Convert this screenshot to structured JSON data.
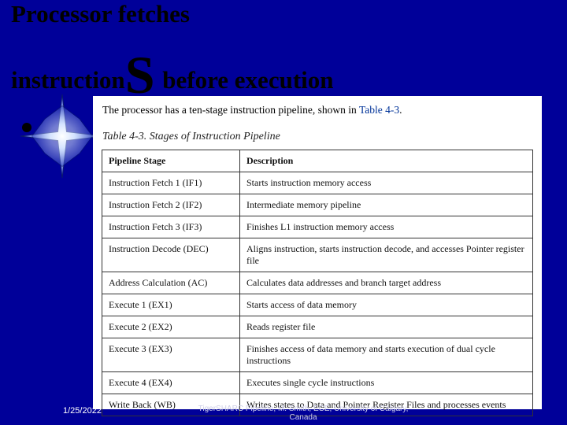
{
  "title": {
    "line1": "Processor fetches",
    "line2a": "instruction",
    "bigS": "S",
    "line2b": " before execution"
  },
  "intro": {
    "text_before": "The processor has a ten-stage instruction pipeline, shown in ",
    "link_text": "Table 4-3",
    "text_after": "."
  },
  "table_caption": "Table 4-3. Stages of Instruction Pipeline",
  "table": {
    "headers": [
      "Pipeline Stage",
      "Description"
    ],
    "rows": [
      [
        "Instruction Fetch 1 (IF1)",
        "Starts instruction memory access"
      ],
      [
        "Instruction Fetch 2 (IF2)",
        "Intermediate memory pipeline"
      ],
      [
        "Instruction Fetch 3 (IF3)",
        "Finishes L1 instruction memory access"
      ],
      [
        "Instruction Decode (DEC)",
        "Aligns instruction, starts instruction decode, and accesses Pointer register file"
      ],
      [
        "Address Calculation (AC)",
        "Calculates data addresses and branch target address"
      ],
      [
        "Execute 1 (EX1)",
        "Starts access of data memory"
      ],
      [
        "Execute 2 (EX2)",
        "Reads register file"
      ],
      [
        "Execute 3 (EX3)",
        "Finishes access of data memory and starts execution of dual cycle instructions"
      ],
      [
        "Execute 4 (EX4)",
        "Executes single cycle instructions"
      ],
      [
        "Write Back (WB)",
        "Writes states to Data and Pointer Register Files and processes events"
      ]
    ]
  },
  "date": "1/25/2022",
  "footer_lines": [
    "TigerSHARC Pipeline, M. Smith, ECE, University of Calgary,",
    "Canada"
  ],
  "colors": {
    "slide_bg": "#000099",
    "link": "#003399"
  }
}
